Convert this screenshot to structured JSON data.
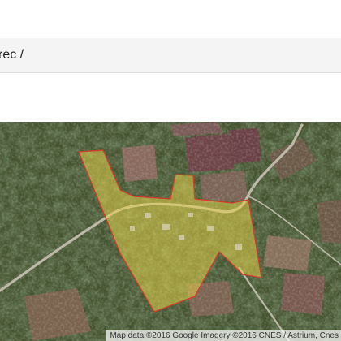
{
  "header": {
    "breadcrumb": "rec /"
  },
  "map": {
    "type": "satellite",
    "attribution": "Map data ©2016 Google  Imagery ©2016 CNES / Astrium, Cnes",
    "overlay": {
      "fill_color": "#e8d44a",
      "stroke_color": "#d33a2a"
    }
  }
}
